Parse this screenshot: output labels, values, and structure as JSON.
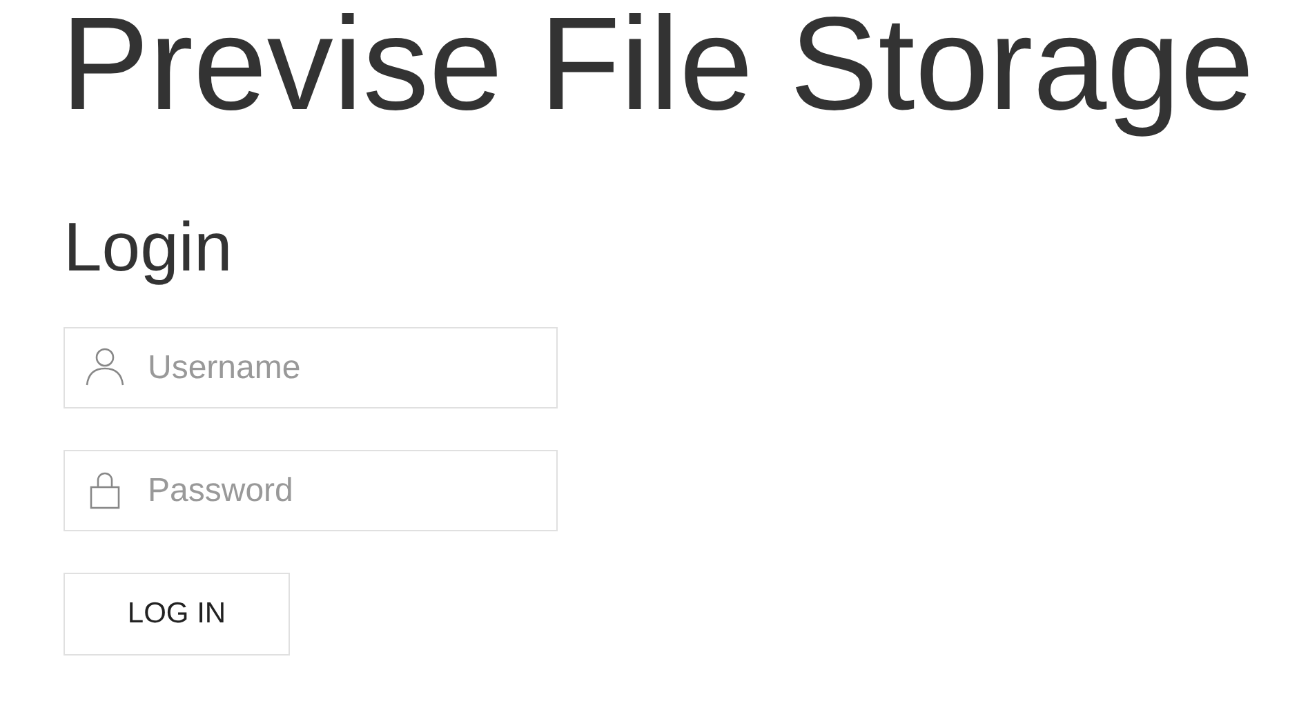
{
  "title": "Previse File Storage",
  "heading": "Login",
  "fields": [
    {
      "kind": "user",
      "placeholder": "Username"
    },
    {
      "kind": "password",
      "placeholder": "Password"
    }
  ],
  "button": "LOG IN"
}
